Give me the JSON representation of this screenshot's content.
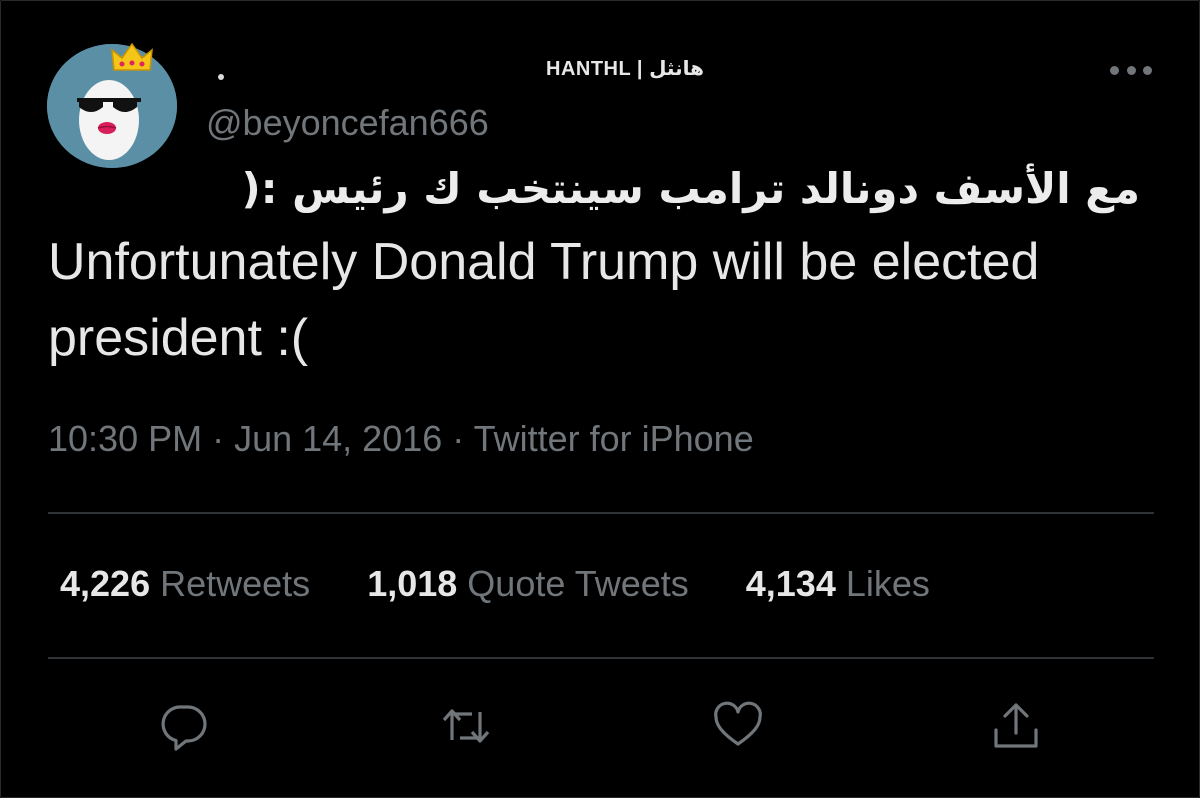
{
  "tweet": {
    "display_name": "HANTHL | هانثل",
    "handle": "@beyoncefan666",
    "text_arabic": "مع الأسف دونالد ترامب سينتخب ك رئيس :(",
    "text_english": "Unfortunately Donald Trump will be elected president :(",
    "meta": "10:30 PM · Jun 14, 2016 · Twitter for iPhone"
  },
  "stats": [
    {
      "count": "4,226",
      "label": "Retweets"
    },
    {
      "count": "1,018",
      "label": "Quote Tweets"
    },
    {
      "count": "4,134",
      "label": "Likes"
    }
  ],
  "icons": {
    "avatar": "avatar-egg-sunglasses-crown",
    "more": "more-dots-icon",
    "reply": "reply-bubble-icon",
    "retweet": "retweet-icon",
    "like": "heart-icon",
    "share": "share-icon"
  },
  "colors": {
    "background": "#000000",
    "text_primary": "#e7e7e7",
    "text_secondary": "#71767b",
    "divider": "#2f3336",
    "avatar_bg": "#5b8fa6"
  }
}
